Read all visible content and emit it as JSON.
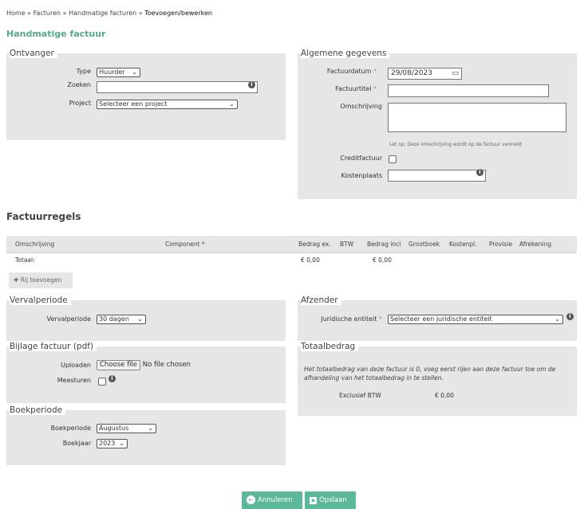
{
  "breadcrumb": {
    "home": "Home",
    "sep": "»",
    "invoices": "Facturen",
    "manual": "Handmatige facturen",
    "current": "Toevoegen/bewerken"
  },
  "page_title": "Handmatige factuur",
  "recipient": {
    "legend": "Ontvanger",
    "type_label": "Type",
    "type_value": "Huurder",
    "search_label": "Zoeken",
    "search_value": "",
    "project_label": "Project",
    "project_value": "Selecteer een project"
  },
  "general": {
    "legend": "Algemene gegevens",
    "date_label": "Factuurdatum",
    "date_value": "29/08/2023",
    "title_label": "Factuurtitel",
    "title_value": "",
    "desc_label": "Omschrijving",
    "desc_value": "",
    "desc_note": "Let op: Deze omschrijving wordt op de factuur vermeld",
    "credit_label": "Creditfactuur",
    "cost_label": "Kostenplaats",
    "cost_value": ""
  },
  "lines": {
    "title": "Factuurregels",
    "headers": [
      "Omschrijving",
      "Component *",
      "Bedrag ex.",
      "BTW",
      "Bedrag incl",
      "Grootboek",
      "Kostenpl.",
      "Provisie",
      "Afrekening"
    ],
    "total_label": "Totaal:",
    "total_ex": "€ 0,00",
    "total_incl": "€ 0,00",
    "add_row": "Rij toevoegen"
  },
  "expiry": {
    "legend": "Vervalperiode",
    "label": "Vervalperiode",
    "value": "30 dagen"
  },
  "sender": {
    "legend": "Afzender",
    "label": "Juridische entiteit",
    "value": "Selecteer een juridische entiteit"
  },
  "attachment": {
    "legend": "Bijlage factuur (pdf)",
    "upload_label": "Uploaden",
    "choose_button": "Choose file",
    "file_status": "No file chosen",
    "send_label": "Meesturen"
  },
  "total": {
    "legend": "Totaalbedrag",
    "note": "Het totaalbedrag van deze factuur is 0, voeg eerst rijen aan deze factuur toe om de afhandeling van het totaalbedrag in te stellen.",
    "excl_label": "Exclusief BTW",
    "excl_value": "€ 0,00"
  },
  "booking": {
    "legend": "Boekperiode",
    "period_label": "Boekperiode",
    "period_value": "Augustus",
    "year_label": "Boekjaar",
    "year_value": "2023"
  },
  "actions": {
    "cancel": "Annuleren",
    "save": "Opslaan"
  },
  "colors": {
    "accent": "#5cb89a",
    "title": "#55a890",
    "panel": "#e6e6e6"
  }
}
